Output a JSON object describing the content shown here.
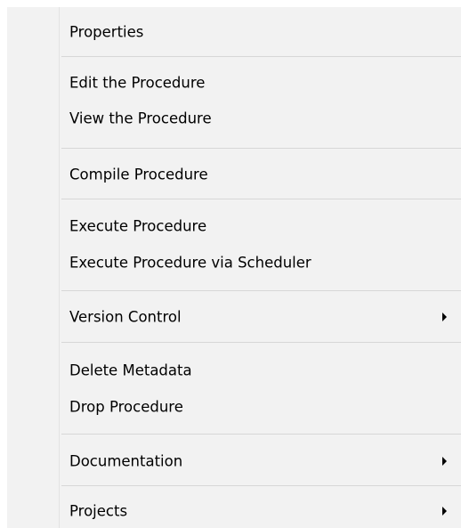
{
  "context_menu": {
    "items": [
      {
        "label": "Properties"
      },
      {
        "label": "Edit the Procedure"
      },
      {
        "label": "View the Procedure"
      },
      {
        "label": "Compile Procedure"
      },
      {
        "label": "Execute Procedure"
      },
      {
        "label": "Execute Procedure via Scheduler"
      },
      {
        "label": "Version Control",
        "submenu_icon": "submenu-arrow-icon"
      },
      {
        "label": "Delete Metadata"
      },
      {
        "label": "Drop Procedure"
      },
      {
        "label": "Documentation",
        "submenu_icon": "submenu-arrow-icon"
      },
      {
        "label": "Projects",
        "submenu_icon": "submenu-arrow-icon"
      }
    ]
  }
}
